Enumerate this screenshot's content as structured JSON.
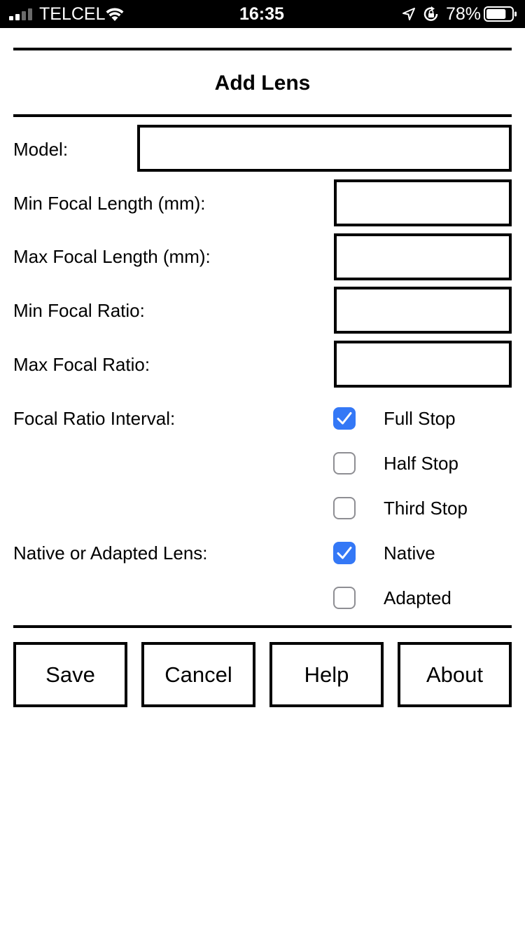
{
  "status_bar": {
    "carrier": "TELCEL",
    "time": "16:35",
    "battery_percent_label": "78%",
    "battery_level": 0.78
  },
  "title": "Add Lens",
  "form": {
    "model_label": "Model:",
    "model_value": "",
    "min_focal_length_label": "Min Focal Length (mm):",
    "min_focal_length_value": "",
    "max_focal_length_label": "Max Focal Length (mm):",
    "max_focal_length_value": "",
    "min_focal_ratio_label": "Min Focal Ratio:",
    "min_focal_ratio_value": "",
    "max_focal_ratio_label": "Max Focal Ratio:",
    "max_focal_ratio_value": "",
    "focal_ratio_interval_label": "Focal Ratio Interval:",
    "interval_options": [
      {
        "label": "Full Stop",
        "checked": true
      },
      {
        "label": "Half Stop",
        "checked": false
      },
      {
        "label": "Third Stop",
        "checked": false
      }
    ],
    "lens_type_label": "Native or Adapted Lens:",
    "lens_type_options": [
      {
        "label": "Native",
        "checked": true
      },
      {
        "label": "Adapted",
        "checked": false
      }
    ]
  },
  "buttons": {
    "save": "Save",
    "cancel": "Cancel",
    "help": "Help",
    "about": "About"
  },
  "colors": {
    "checkbox_checked": "#3478f6",
    "checkbox_unchecked_border": "#8e8e93"
  }
}
